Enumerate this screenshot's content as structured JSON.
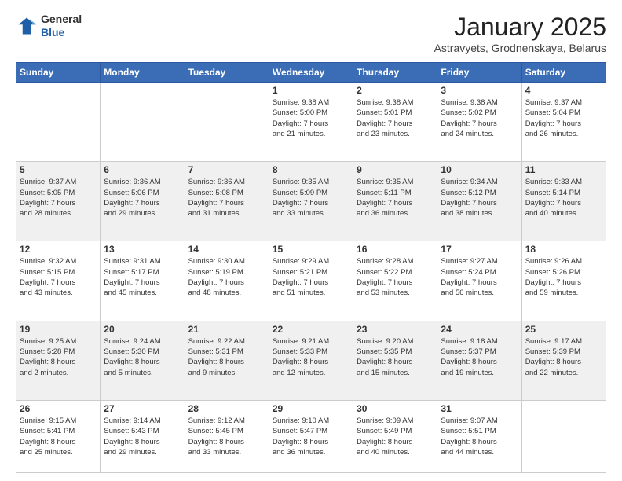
{
  "header": {
    "logo_general": "General",
    "logo_blue": "Blue",
    "month_title": "January 2025",
    "location": "Astravyets, Grodnenskaya, Belarus"
  },
  "days_of_week": [
    "Sunday",
    "Monday",
    "Tuesday",
    "Wednesday",
    "Thursday",
    "Friday",
    "Saturday"
  ],
  "weeks": [
    [
      {
        "day": "",
        "content": ""
      },
      {
        "day": "",
        "content": ""
      },
      {
        "day": "",
        "content": ""
      },
      {
        "day": "1",
        "content": "Sunrise: 9:38 AM\nSunset: 5:00 PM\nDaylight: 7 hours\nand 21 minutes."
      },
      {
        "day": "2",
        "content": "Sunrise: 9:38 AM\nSunset: 5:01 PM\nDaylight: 7 hours\nand 23 minutes."
      },
      {
        "day": "3",
        "content": "Sunrise: 9:38 AM\nSunset: 5:02 PM\nDaylight: 7 hours\nand 24 minutes."
      },
      {
        "day": "4",
        "content": "Sunrise: 9:37 AM\nSunset: 5:04 PM\nDaylight: 7 hours\nand 26 minutes."
      }
    ],
    [
      {
        "day": "5",
        "content": "Sunrise: 9:37 AM\nSunset: 5:05 PM\nDaylight: 7 hours\nand 28 minutes."
      },
      {
        "day": "6",
        "content": "Sunrise: 9:36 AM\nSunset: 5:06 PM\nDaylight: 7 hours\nand 29 minutes."
      },
      {
        "day": "7",
        "content": "Sunrise: 9:36 AM\nSunset: 5:08 PM\nDaylight: 7 hours\nand 31 minutes."
      },
      {
        "day": "8",
        "content": "Sunrise: 9:35 AM\nSunset: 5:09 PM\nDaylight: 7 hours\nand 33 minutes."
      },
      {
        "day": "9",
        "content": "Sunrise: 9:35 AM\nSunset: 5:11 PM\nDaylight: 7 hours\nand 36 minutes."
      },
      {
        "day": "10",
        "content": "Sunrise: 9:34 AM\nSunset: 5:12 PM\nDaylight: 7 hours\nand 38 minutes."
      },
      {
        "day": "11",
        "content": "Sunrise: 9:33 AM\nSunset: 5:14 PM\nDaylight: 7 hours\nand 40 minutes."
      }
    ],
    [
      {
        "day": "12",
        "content": "Sunrise: 9:32 AM\nSunset: 5:15 PM\nDaylight: 7 hours\nand 43 minutes."
      },
      {
        "day": "13",
        "content": "Sunrise: 9:31 AM\nSunset: 5:17 PM\nDaylight: 7 hours\nand 45 minutes."
      },
      {
        "day": "14",
        "content": "Sunrise: 9:30 AM\nSunset: 5:19 PM\nDaylight: 7 hours\nand 48 minutes."
      },
      {
        "day": "15",
        "content": "Sunrise: 9:29 AM\nSunset: 5:21 PM\nDaylight: 7 hours\nand 51 minutes."
      },
      {
        "day": "16",
        "content": "Sunrise: 9:28 AM\nSunset: 5:22 PM\nDaylight: 7 hours\nand 53 minutes."
      },
      {
        "day": "17",
        "content": "Sunrise: 9:27 AM\nSunset: 5:24 PM\nDaylight: 7 hours\nand 56 minutes."
      },
      {
        "day": "18",
        "content": "Sunrise: 9:26 AM\nSunset: 5:26 PM\nDaylight: 7 hours\nand 59 minutes."
      }
    ],
    [
      {
        "day": "19",
        "content": "Sunrise: 9:25 AM\nSunset: 5:28 PM\nDaylight: 8 hours\nand 2 minutes."
      },
      {
        "day": "20",
        "content": "Sunrise: 9:24 AM\nSunset: 5:30 PM\nDaylight: 8 hours\nand 5 minutes."
      },
      {
        "day": "21",
        "content": "Sunrise: 9:22 AM\nSunset: 5:31 PM\nDaylight: 8 hours\nand 9 minutes."
      },
      {
        "day": "22",
        "content": "Sunrise: 9:21 AM\nSunset: 5:33 PM\nDaylight: 8 hours\nand 12 minutes."
      },
      {
        "day": "23",
        "content": "Sunrise: 9:20 AM\nSunset: 5:35 PM\nDaylight: 8 hours\nand 15 minutes."
      },
      {
        "day": "24",
        "content": "Sunrise: 9:18 AM\nSunset: 5:37 PM\nDaylight: 8 hours\nand 19 minutes."
      },
      {
        "day": "25",
        "content": "Sunrise: 9:17 AM\nSunset: 5:39 PM\nDaylight: 8 hours\nand 22 minutes."
      }
    ],
    [
      {
        "day": "26",
        "content": "Sunrise: 9:15 AM\nSunset: 5:41 PM\nDaylight: 8 hours\nand 25 minutes."
      },
      {
        "day": "27",
        "content": "Sunrise: 9:14 AM\nSunset: 5:43 PM\nDaylight: 8 hours\nand 29 minutes."
      },
      {
        "day": "28",
        "content": "Sunrise: 9:12 AM\nSunset: 5:45 PM\nDaylight: 8 hours\nand 33 minutes."
      },
      {
        "day": "29",
        "content": "Sunrise: 9:10 AM\nSunset: 5:47 PM\nDaylight: 8 hours\nand 36 minutes."
      },
      {
        "day": "30",
        "content": "Sunrise: 9:09 AM\nSunset: 5:49 PM\nDaylight: 8 hours\nand 40 minutes."
      },
      {
        "day": "31",
        "content": "Sunrise: 9:07 AM\nSunset: 5:51 PM\nDaylight: 8 hours\nand 44 minutes."
      },
      {
        "day": "",
        "content": ""
      }
    ]
  ]
}
